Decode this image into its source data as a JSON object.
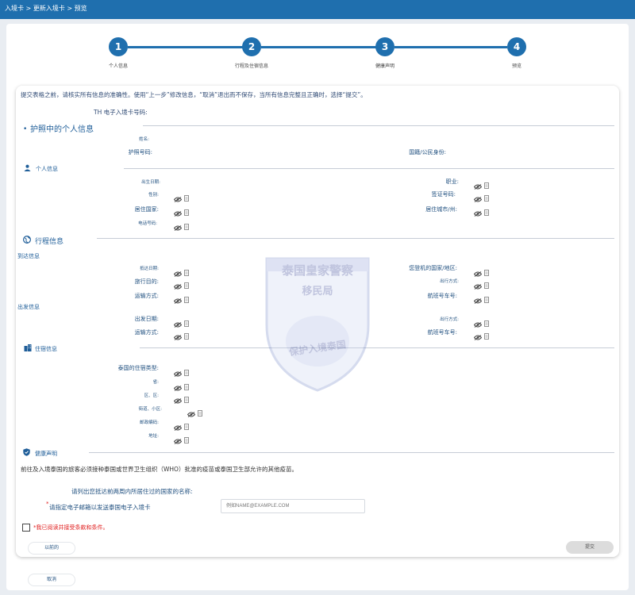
{
  "breadcrumb": "入境卡 > 更新入境卡 > 预览",
  "steps": [
    {
      "num": "1",
      "label": "个人信息"
    },
    {
      "num": "2",
      "label": "行程及住宿信息"
    },
    {
      "num": "3",
      "label": "健康声明"
    },
    {
      "num": "4",
      "label": "预览"
    }
  ],
  "instruction": "提交表格之前，请核实所有信息的准确性。使用“上一步”修改信息，“取消”退出而不保存，当所有信息完整且正确时，选择“提交”。",
  "card_no_label": "TH 电子入境卡号码:",
  "passport_section": {
    "title": "护照中的个人信息",
    "name_label": "姓名:",
    "passport_no_label": "护照号码:",
    "nationality_label": "国籍/公民身份:"
  },
  "personal": {
    "title": "个人信息",
    "dob": "出生日期:",
    "occupation": "职业:",
    "gender": "性别:",
    "visa_no": "签证号码:",
    "country_res": "居住国家:",
    "city_res": "居住城市/州:",
    "phone": "电话号码:"
  },
  "travel": {
    "title": "行程信息",
    "arrival_title": "到达信息",
    "arrival_date": "抵达日期:",
    "boarding_country": "您登机的国家/地区:",
    "purpose": "旅行目的:",
    "travel_mode_1": "出行方式:",
    "transport_mode_1": "运输方式:",
    "flight_no_1": "航班号车号:",
    "departure_title": "出发信息",
    "departure_date": "出发日期:",
    "travel_mode_2": "出行方式:",
    "transport_mode_2": "运输方式:",
    "flight_no_2": "航班号车号:"
  },
  "accommodation": {
    "title": "住宿信息",
    "type": "泰国的住宿类型:",
    "province": "省:",
    "district": "区、区:",
    "subdistrict": "街道、小区:",
    "postcode": "邮政编码:",
    "address": "地址:"
  },
  "health": {
    "title": "健康声明",
    "statement": "前往及入境泰国的旅客必须接种泰国或世界卫生组织（WHO）批准的疫苗或泰国卫生部允许的其他疫苗。",
    "countries_label": "请列出您抵达前两周内所居住过的国家的名称:",
    "email_label": "请指定电子邮箱以发送泰国电子入境卡",
    "email_placeholder": "例如NAME@EXAMPLE.COM",
    "agree_label": "*我已阅读并接受条款和条件。"
  },
  "buttons": {
    "previous": "以前的",
    "submit": "提交",
    "cancel": "取消"
  },
  "watermark": {
    "line1": "泰国皇家警察",
    "line2": "移民局",
    "line3": "保护入境泰国"
  },
  "colors": {
    "primary": "#1f6fae",
    "warning": "#e02020"
  }
}
